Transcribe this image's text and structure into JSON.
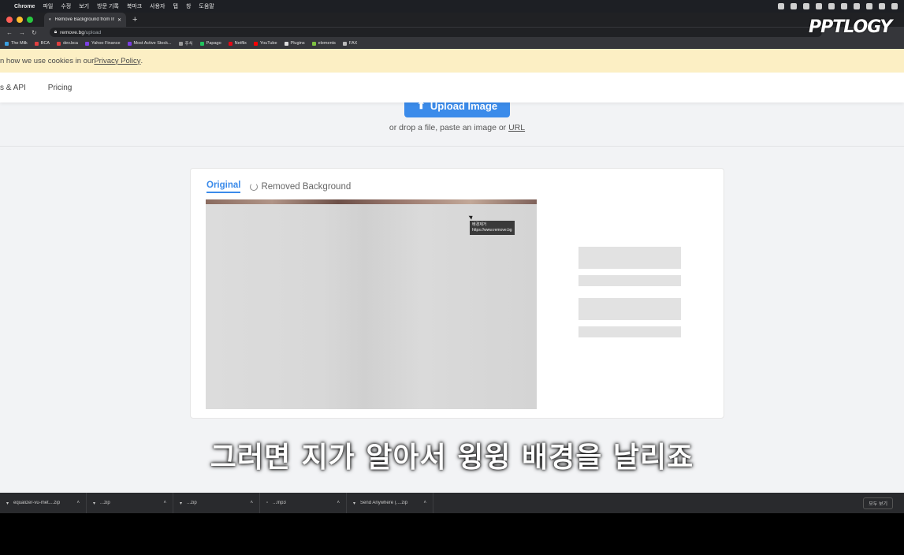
{
  "menubar": {
    "app_name": "Chrome",
    "menus": [
      "파일",
      "수정",
      "보기",
      "방문 기록",
      "북마크",
      "사용자",
      "탭",
      "창",
      "도움말"
    ]
  },
  "tabbar": {
    "tab_title": "Remove Background from Ima",
    "new_tab": "+"
  },
  "address": {
    "domain": "remove.bg",
    "path": "/upload"
  },
  "bookmarks": [
    {
      "label": "The Milk",
      "color": "#3aa0e0"
    },
    {
      "label": "BCA",
      "color": "#e04040"
    },
    {
      "label": "dev.bca",
      "color": "#e04040"
    },
    {
      "label": "Yahoo Finance",
      "color": "#7b3fe4"
    },
    {
      "label": "Most Active Stock...",
      "color": "#7b3fe4"
    },
    {
      "label": "주식",
      "color": "#999999"
    },
    {
      "label": "Papago",
      "color": "#22c55e"
    },
    {
      "label": "Netflix",
      "color": "#e50914"
    },
    {
      "label": "YouTube",
      "color": "#ff0000"
    },
    {
      "label": "Plugins",
      "color": "#dddddd"
    },
    {
      "label": "elements",
      "color": "#7fc241"
    },
    {
      "label": "FAX",
      "color": "#bbbbbb"
    }
  ],
  "overlay_logo": "PPTLOGY",
  "cookie": {
    "text": "n how we use cookies in our ",
    "link": "Privacy Policy",
    "suffix": "."
  },
  "nav": {
    "items": [
      "s & API",
      "Pricing"
    ]
  },
  "upload": {
    "button_label": "Upload Image",
    "hint_prefix": "or drop a file, paste an image or ",
    "hint_link": "URL"
  },
  "preview": {
    "tab_original": "Original",
    "tab_removed": "Removed Background",
    "tooltip_line1": "배경제거",
    "tooltip_line2": "https://www.remove.bg"
  },
  "subtitle": "그러면 지가 알아서 윙윙 배경을 날리죠",
  "downloads": {
    "items": [
      "equalizer-vu-met....zip",
      "...zip",
      "...zip",
      "...mp3",
      "Send Anywhere (....zip"
    ],
    "show_all": "모두 보기"
  },
  "colors": {
    "accent": "#3b8bea",
    "cookie_bg": "#fcefc4",
    "page_bg": "#f2f3f5"
  }
}
